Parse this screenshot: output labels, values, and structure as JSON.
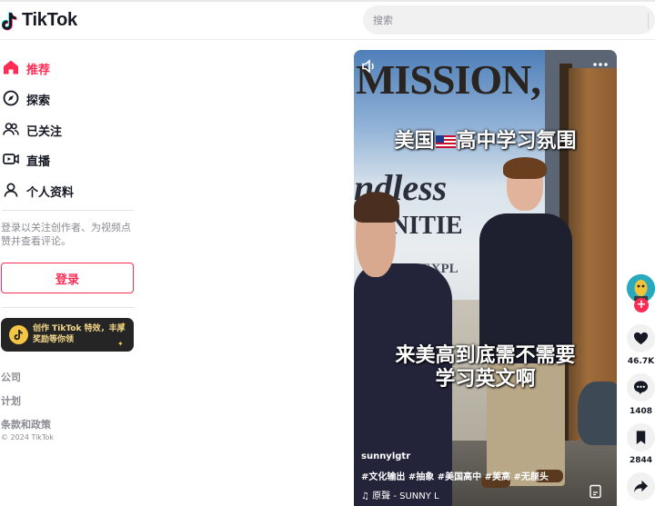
{
  "app": {
    "name": "TikTok"
  },
  "search": {
    "placeholder": "搜索"
  },
  "sidebar": {
    "items": [
      {
        "label": "推荐",
        "active": true
      },
      {
        "label": "探索"
      },
      {
        "label": "已关注"
      },
      {
        "label": "直播"
      },
      {
        "label": "个人资料"
      }
    ],
    "login_hint": "登录以关注创作者、为视频点赞并查看评论。",
    "login_button": "登录",
    "banner_text": "创作 TikTok 特效，丰厚奖励等你领",
    "footer": {
      "company": "公司",
      "program": "计划",
      "terms": "条款和政策",
      "copyright": "© 2024 TikTok"
    }
  },
  "video": {
    "poster_words": [
      "MISSION,",
      "ndless",
      "UNITIE",
      "RG/EXPL"
    ],
    "caption_top_prefix": "美国",
    "caption_top_suffix": "高中学习氛围",
    "caption_line1": "来美高到底需不需要",
    "caption_line2": "学习英文啊",
    "author": "sunnylgtr",
    "hashtags": "#文化输出 #抽象 #美国高中 #美高 #无厘头",
    "music": "原聲 - SUNNY L"
  },
  "actions": {
    "likes": "46.7K",
    "comments": "1408",
    "saves": "2844"
  },
  "colors": {
    "accent": "#fe2c55",
    "text": "#161823",
    "muted": "#8a8b91"
  }
}
